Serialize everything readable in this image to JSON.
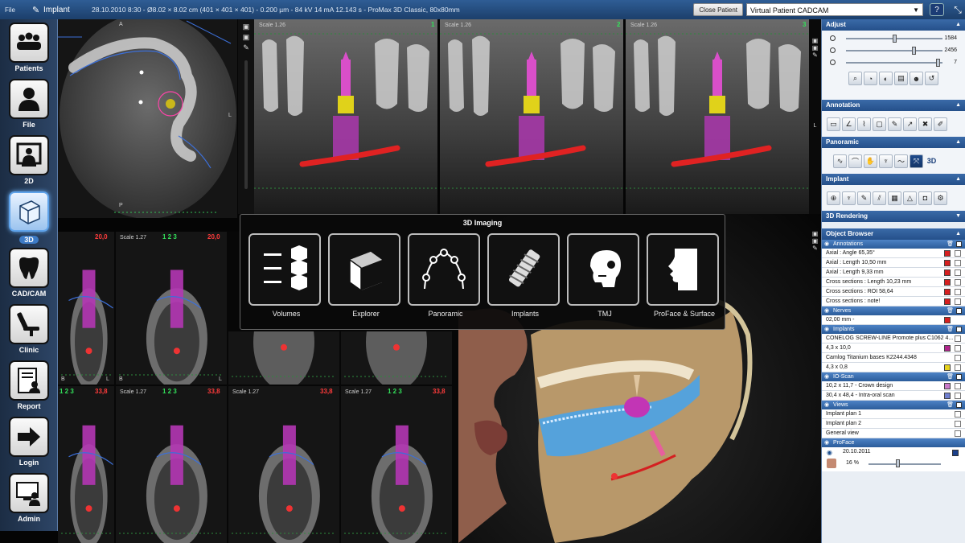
{
  "titlebar": {
    "file_menu": "File",
    "module": "Implant",
    "info": "28.10.2010 8:30 - Ø8.02 × 8.02 cm (401 × 401 × 401) - 0.200 µm - 84 kV 14 mA 12.143 s - ProMax 3D Classic, 80x80mm",
    "close_patient": "Close Patient",
    "patient_name": "Virtual Patient CADCAM",
    "help_icon": "?"
  },
  "launcher": [
    {
      "label": "Patients",
      "icon": "patients-icon"
    },
    {
      "label": "File",
      "icon": "file-icon"
    },
    {
      "label": "2D",
      "icon": "2d-icon"
    },
    {
      "label": "3D",
      "icon": "3d-icon",
      "active": true
    },
    {
      "label": "CAD/CAM",
      "icon": "tooth-icon"
    },
    {
      "label": "Clinic",
      "icon": "dental-chair-icon"
    },
    {
      "label": "Report",
      "icon": "report-icon"
    },
    {
      "label": "Login",
      "icon": "login-arrow-icon"
    },
    {
      "label": "Admin",
      "icon": "admin-icon"
    }
  ],
  "axial": {
    "top_letter": "A",
    "bottom_letter": "P",
    "side_letter": "L"
  },
  "pano": {
    "panels": [
      {
        "scale": "Scale 1.26",
        "index": "1"
      },
      {
        "scale": "Scale 1.26",
        "index": "2"
      },
      {
        "scale": "Scale 1.26",
        "index": "3"
      }
    ],
    "side_letter": "L"
  },
  "cross": {
    "top_row": [
      {
        "scale": "",
        "tag": "",
        "value": "20,0"
      },
      {
        "scale": "Scale 1.27",
        "tag": "1 2 3",
        "value": "20,0"
      }
    ],
    "bottom_row": [
      {
        "scale": "",
        "tag": "1 2 3",
        "value": "33,8"
      },
      {
        "scale": "Scale 1.27",
        "tag": "1 2 3",
        "value": "33,8"
      },
      {
        "scale": "Scale 1.27",
        "tag": "",
        "value": "33,8"
      },
      {
        "scale": "Scale 1.27",
        "tag": "1 2 3",
        "value": "33,8"
      }
    ],
    "b_letter": "B",
    "l_letter": "L"
  },
  "popup": {
    "title": "3D Imaging",
    "items": [
      {
        "label": "Volumes",
        "icon": "volumes-icon"
      },
      {
        "label": "Explorer",
        "icon": "cube-icon"
      },
      {
        "label": "Panoramic",
        "icon": "panoramic-curve-icon"
      },
      {
        "label": "Implants",
        "icon": "implant-screw-icon"
      },
      {
        "label": "TMJ",
        "icon": "skull-icon"
      },
      {
        "label": "ProFace & Surface",
        "icon": "face-profile-icon"
      }
    ]
  },
  "right_panel": {
    "adjust": {
      "title": "Adjust",
      "sliders": [
        {
          "value": "1584",
          "level": 0.5
        },
        {
          "value": "2456",
          "level": 0.7
        },
        {
          "value": "7",
          "level": 0.95
        }
      ]
    },
    "annotation": {
      "title": "Annotation"
    },
    "panoramic": {
      "title": "Panoramic",
      "label_3d": "3D"
    },
    "implant": {
      "title": "Implant"
    },
    "rendering": {
      "title": "3D Rendering"
    },
    "object_browser": {
      "title": "Object Browser",
      "annotations_header": "Annotations",
      "annotations": [
        {
          "text": "Axial : Angle 65,35°",
          "color": "#d61f1f"
        },
        {
          "text": "Axial : Length 10,50 mm",
          "color": "#d61f1f"
        },
        {
          "text": "Axial : Length 9,33 mm",
          "color": "#d61f1f"
        },
        {
          "text": "Cross sections : Length 10,23 mm",
          "color": "#d61f1f"
        },
        {
          "text": "Cross sections : ROI 58,64",
          "color": "#d61f1f"
        },
        {
          "text": "Cross sections : note!",
          "color": "#d61f1f"
        }
      ],
      "nerves_header": "Nerves",
      "nerves": [
        {
          "text": "02,00 mm -",
          "color": "#d61f1f"
        }
      ],
      "implants_header": "Implants",
      "implants": [
        {
          "text": "CONELOG SCREW-LINE Promote plus C1062 4...",
          "color": ""
        },
        {
          "text": "4,3 x 10,0",
          "color": "#b0248c"
        },
        {
          "text": "Camlog Titanium bases K2244.4348",
          "color": ""
        },
        {
          "text": "4,3 x 0,8",
          "color": "#e6d21c"
        }
      ],
      "ioscan_header": "IO-Scan",
      "ioscan": [
        {
          "text": "10,2 x 11,7 - Crown design",
          "color": "#c97ac9"
        },
        {
          "text": "30,4 x 48,4 - Intra-oral scan",
          "color": "#6f7fd0"
        }
      ],
      "views_header": "Views",
      "views": [
        {
          "text": "Implant plan 1"
        },
        {
          "text": "Implant plan 2"
        },
        {
          "text": "General view"
        }
      ],
      "proface_header": "ProFace",
      "proface": {
        "date": "20.10.2011",
        "percent": "16 %",
        "level": 0.16
      }
    }
  }
}
